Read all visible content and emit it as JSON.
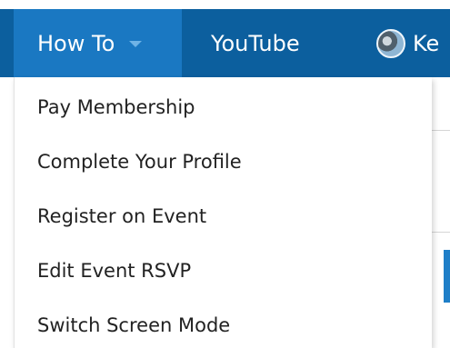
{
  "navbar": {
    "how_to_label": "How To",
    "youtube_label": "YouTube",
    "user_label_partial": "Ke"
  },
  "dropdown": {
    "items": [
      {
        "label": "Pay Membership"
      },
      {
        "label": "Complete Your Profile"
      },
      {
        "label": "Register on Event"
      },
      {
        "label": "Edit Event RSVP"
      },
      {
        "label": "Switch Screen Mode"
      }
    ]
  },
  "colors": {
    "navbar": "#0c5f9e",
    "active_nav_item": "#1a78c2",
    "menu_text": "#222222"
  },
  "icons": {
    "dropdown_caret": "caret-down-icon",
    "user_avatar": "avatar"
  }
}
